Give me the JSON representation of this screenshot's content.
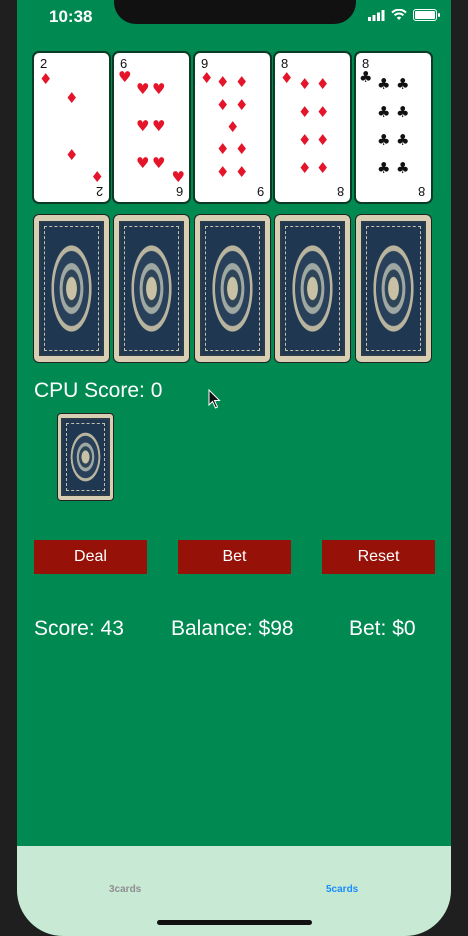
{
  "status_bar": {
    "time": "10:38"
  },
  "player_cards": [
    {
      "rank": "2",
      "suit": "♦",
      "color": "red"
    },
    {
      "rank": "6",
      "suit": "♥",
      "color": "red"
    },
    {
      "rank": "9",
      "suit": "♦",
      "color": "red"
    },
    {
      "rank": "8",
      "suit": "♦",
      "color": "red"
    },
    {
      "rank": "8",
      "suit": "♣",
      "color": "black"
    }
  ],
  "cpu_score_label": "CPU Score: 0",
  "buttons": {
    "deal": "Deal",
    "bet": "Bet",
    "reset": "Reset"
  },
  "stats": {
    "score": "Score: 43",
    "balance": "Balance: $98",
    "bet": "Bet: $0"
  },
  "tabs": [
    {
      "label": "3cards",
      "active": false
    },
    {
      "label": "5cards",
      "active": true
    }
  ],
  "colors": {
    "table": "#008a52",
    "button": "#961209",
    "tabbar": "#c8e9d3",
    "tab_active": "#1a8cff",
    "tab_inactive": "#8e8e93"
  }
}
